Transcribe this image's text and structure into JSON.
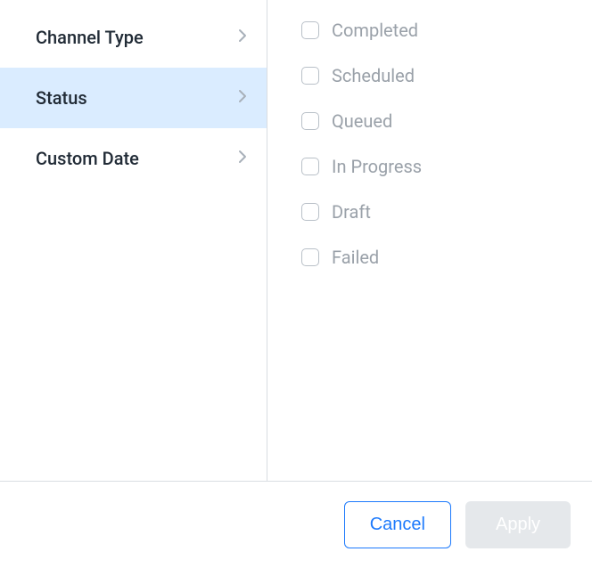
{
  "sidebar": {
    "items": [
      {
        "id": "channel-type",
        "label": "Channel Type",
        "active": false
      },
      {
        "id": "status",
        "label": "Status",
        "active": true
      },
      {
        "id": "custom-date",
        "label": "Custom Date",
        "active": false
      }
    ]
  },
  "status_options": [
    {
      "id": "completed",
      "label": "Completed",
      "checked": false
    },
    {
      "id": "scheduled",
      "label": "Scheduled",
      "checked": false
    },
    {
      "id": "queued",
      "label": "Queued",
      "checked": false
    },
    {
      "id": "in-progress",
      "label": "In Progress",
      "checked": false
    },
    {
      "id": "draft",
      "label": "Draft",
      "checked": false
    },
    {
      "id": "failed",
      "label": "Failed",
      "checked": false
    }
  ],
  "footer": {
    "cancel_label": "Cancel",
    "apply_label": "Apply",
    "apply_disabled": true
  }
}
